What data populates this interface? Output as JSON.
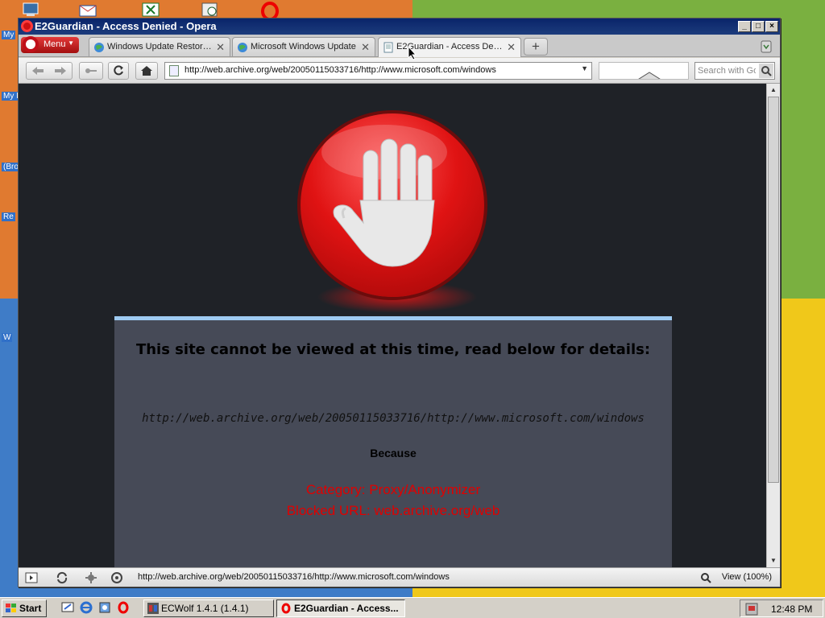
{
  "window": {
    "title": "E2Guardian - Access Denied - Opera",
    "buttons": [
      "minimize",
      "maximize",
      "close"
    ]
  },
  "menu_button": {
    "label": "Menu"
  },
  "tabs": [
    {
      "label": "Windows Update Restor…",
      "active": false
    },
    {
      "label": "Microsoft Windows Update",
      "active": false
    },
    {
      "label": "E2Guardian - Access De…",
      "active": true
    }
  ],
  "address_bar": {
    "url": "http://web.archive.org/web/20050115033716/http://www.microsoft.com/windows"
  },
  "search": {
    "placeholder": "Search with Go"
  },
  "block_page": {
    "heading": "This site cannot be viewed at this time, read below for details:",
    "url": "http://web.archive.org/web/20050115033716/http://www.microsoft.com/windows",
    "because": "Because",
    "category": "Category: Proxy/Anonymizer",
    "blocked_url": "Blocked URL: web.archive.org/web"
  },
  "status_bar": {
    "url": "http://web.archive.org/web/20050115033716/http://www.microsoft.com/windows",
    "zoom": "View (100%)"
  },
  "taskbar": {
    "start_label": "Start",
    "tasks": [
      {
        "label": "ECWolf 1.4.1 (1.4.1)",
        "active": false
      },
      {
        "label": "E2Guardian - Access...",
        "active": true
      }
    ],
    "clock": "12:48 PM"
  },
  "desktop_labels": [
    "My",
    "My I",
    "(Bro",
    "Re",
    "W"
  ],
  "colors": {
    "titlebar": "#0a246a",
    "page_bg": "#1f2227",
    "panel_bg": "#464a57",
    "panel_border": "#9ecbf2",
    "stop_red": "#e01313",
    "reason_text": "#e00000"
  }
}
